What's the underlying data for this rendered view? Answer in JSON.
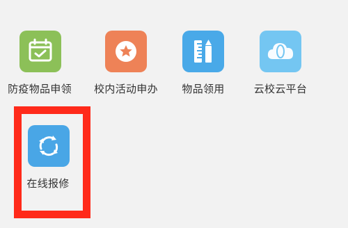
{
  "apps": [
    {
      "label": "防疫物品申领",
      "icon": "calendar-check-icon",
      "color": "#8cc058"
    },
    {
      "label": "校内活动申办",
      "icon": "star-badge-icon",
      "color": "#ee8257"
    },
    {
      "label": "物品领用",
      "icon": "ruler-pencil-icon",
      "color": "#49a9e8"
    },
    {
      "label": "云校云平台",
      "icon": "cloud-icon",
      "color": "#74c6f2"
    },
    {
      "label": "在线报修",
      "icon": "refresh-cycle-icon",
      "color": "#49a6e6"
    }
  ],
  "highlight": {
    "color": "#ff2a1a",
    "target": "在线报修"
  }
}
